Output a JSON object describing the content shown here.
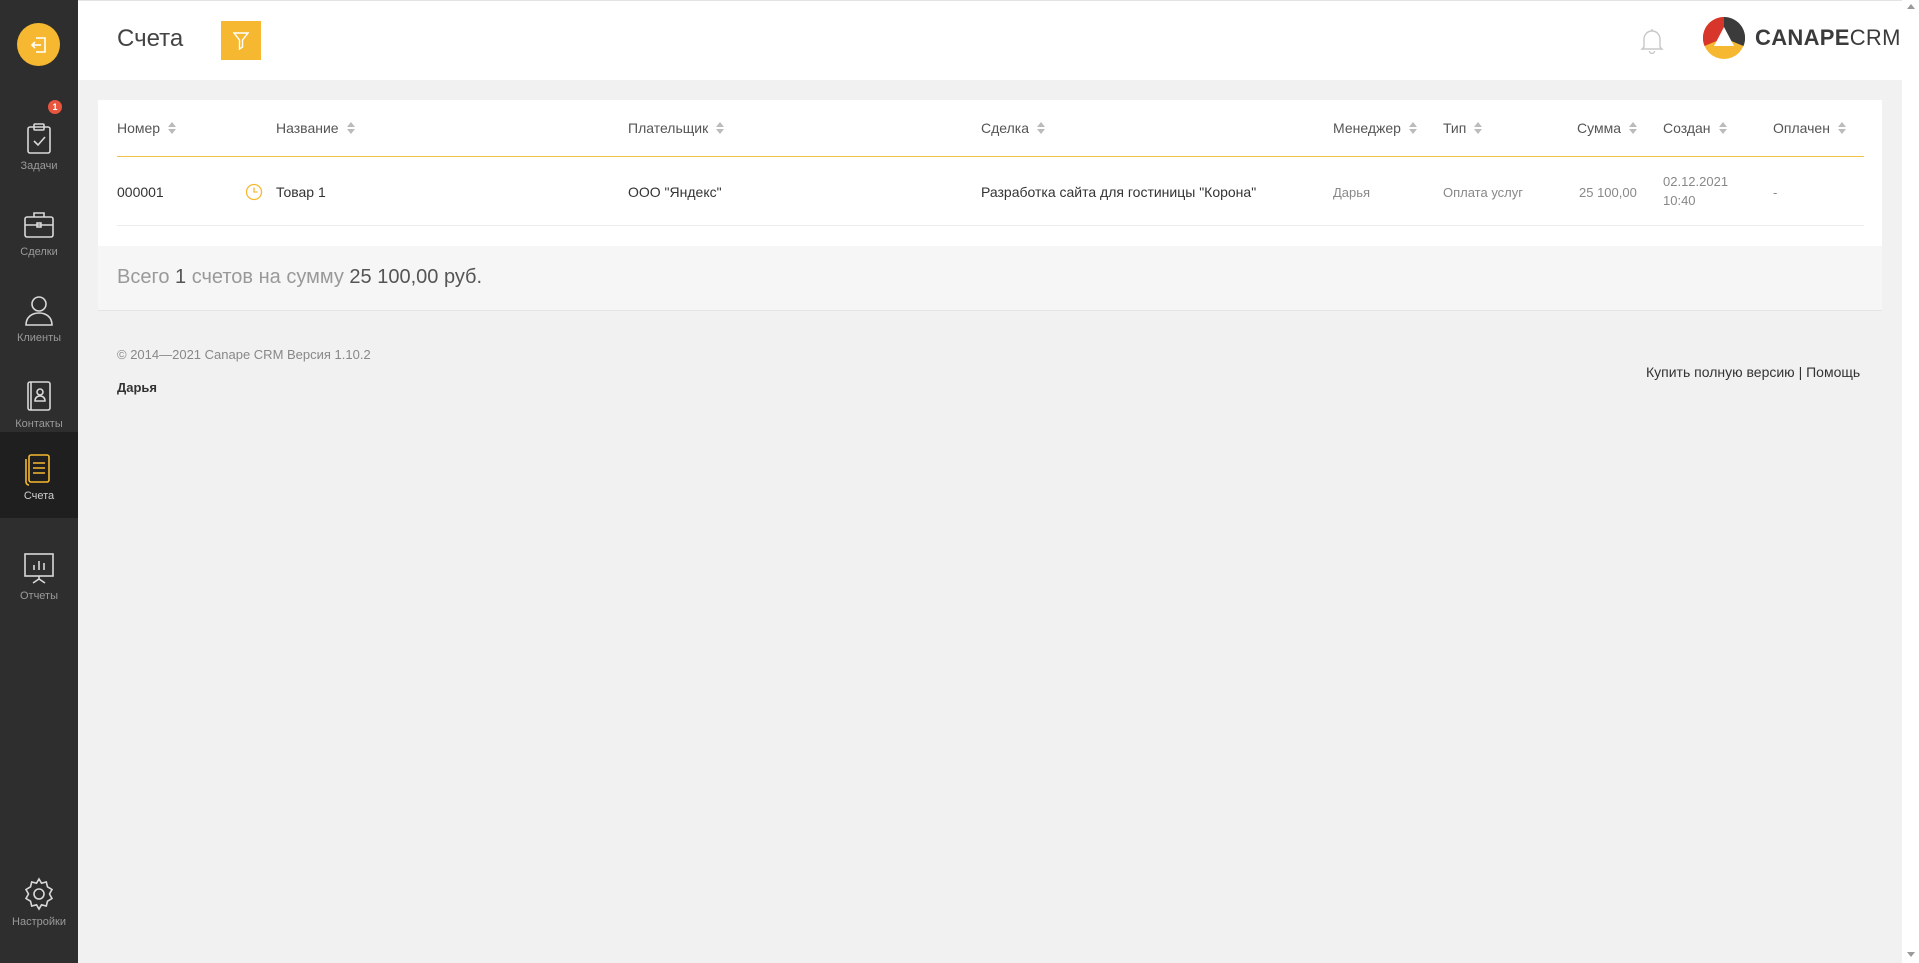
{
  "sidebar": {
    "logout_icon": "logout-icon",
    "badge": "1",
    "items": [
      {
        "label": "Задачи",
        "icon": "clipboard-check-icon"
      },
      {
        "label": "Сделки",
        "icon": "briefcase-icon"
      },
      {
        "label": "Клиенты",
        "icon": "user-icon"
      },
      {
        "label": "Контакты",
        "icon": "contact-book-icon"
      },
      {
        "label": "Счета",
        "icon": "invoice-icon",
        "active": true
      },
      {
        "label": "Отчеты",
        "icon": "presentation-chart-icon"
      },
      {
        "label": "Настройки",
        "icon": "gear-icon"
      }
    ]
  },
  "header": {
    "title": "Счета",
    "filter_icon": "filter-icon",
    "bell_icon": "bell-icon",
    "brand_bold": "CANAPE",
    "brand_light": "CRM"
  },
  "table": {
    "columns": [
      "Номер",
      "Название",
      "Плательщик",
      "Сделка",
      "Менеджер",
      "Тип",
      "Сумма",
      "Создан",
      "Оплачен"
    ],
    "rows": [
      {
        "number": "000001",
        "status_icon": "clock-icon",
        "name": "Товар 1",
        "payer": "ООО \"Яндекс\"",
        "deal": "Разработка сайта для гостиницы \"Корона\"",
        "manager": "Дарья",
        "type": "Оплата услуг",
        "amount": "25 100,00",
        "created_date": "02.12.2021",
        "created_time": "10:40",
        "paid": "-"
      }
    ]
  },
  "summary": {
    "prefix": "Всего",
    "count": "1",
    "middle": "счетов на сумму",
    "total": "25 100,00",
    "currency": "руб."
  },
  "footer": {
    "copyright": "© 2014—2021 Canape CRM Версия 1.10.2",
    "user": "Дарья",
    "buy_link": "Купить полную версию",
    "separator": "|",
    "help_link": "Помощь"
  },
  "colors": {
    "accent": "#f6b830",
    "sidebar": "#2e2e2e",
    "badge": "#e8563f"
  }
}
